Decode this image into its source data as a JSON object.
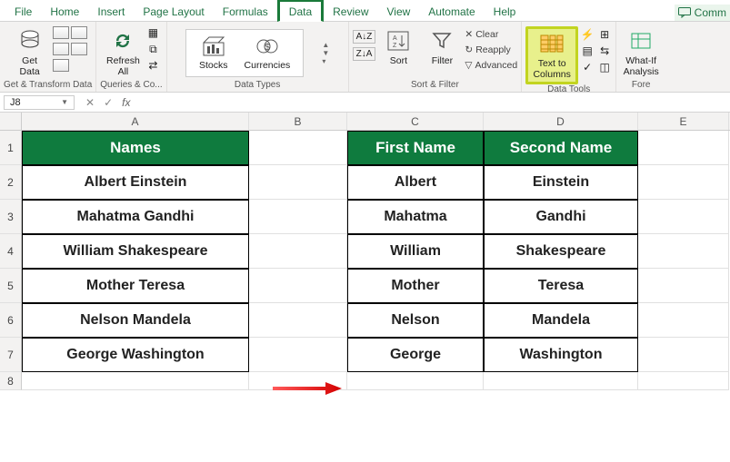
{
  "tabs": {
    "file": "File",
    "home": "Home",
    "insert": "Insert",
    "pagelayout": "Page Layout",
    "formulas": "Formulas",
    "data": "Data",
    "review": "Review",
    "view": "View",
    "automate": "Automate",
    "help": "Help",
    "comments": "Comm"
  },
  "ribbon": {
    "getdata": "Get Data",
    "refreshall": "Refresh All",
    "stocks": "Stocks",
    "currencies": "Currencies",
    "sort": "Sort",
    "filter": "Filter",
    "clear": "Clear",
    "reapply": "Reapply",
    "advanced": "Advanced",
    "texttocolumns": "Text to Columns",
    "whatif": "What-If Analysis",
    "groups": {
      "g1": "Get & Transform Data",
      "g2": "Queries & Co...",
      "g3": "Data Types",
      "g4": "Sort & Filter",
      "g5": "Data Tools",
      "g6": "Fore"
    }
  },
  "namebox": "J8",
  "sheet": {
    "cols": {
      "a": "A",
      "b": "B",
      "c": "C",
      "d": "D",
      "e": "E"
    },
    "rows": [
      "1",
      "2",
      "3",
      "4",
      "5",
      "6",
      "7",
      "8"
    ],
    "headers": {
      "names": "Names",
      "first": "First Name",
      "second": "Second Name"
    },
    "names": [
      {
        "full": "Albert Einstein",
        "first": "Albert",
        "second": "Einstein"
      },
      {
        "full": "Mahatma Gandhi",
        "first": "Mahatma",
        "second": "Gandhi"
      },
      {
        "full": "William Shakespeare",
        "first": "William",
        "second": "Shakespeare"
      },
      {
        "full": "Mother Teresa",
        "first": "Mother",
        "second": "Teresa"
      },
      {
        "full": "Nelson Mandela",
        "first": "Nelson",
        "second": "Mandela"
      },
      {
        "full": "George Washington",
        "first": "George",
        "second": "Washington"
      }
    ]
  }
}
